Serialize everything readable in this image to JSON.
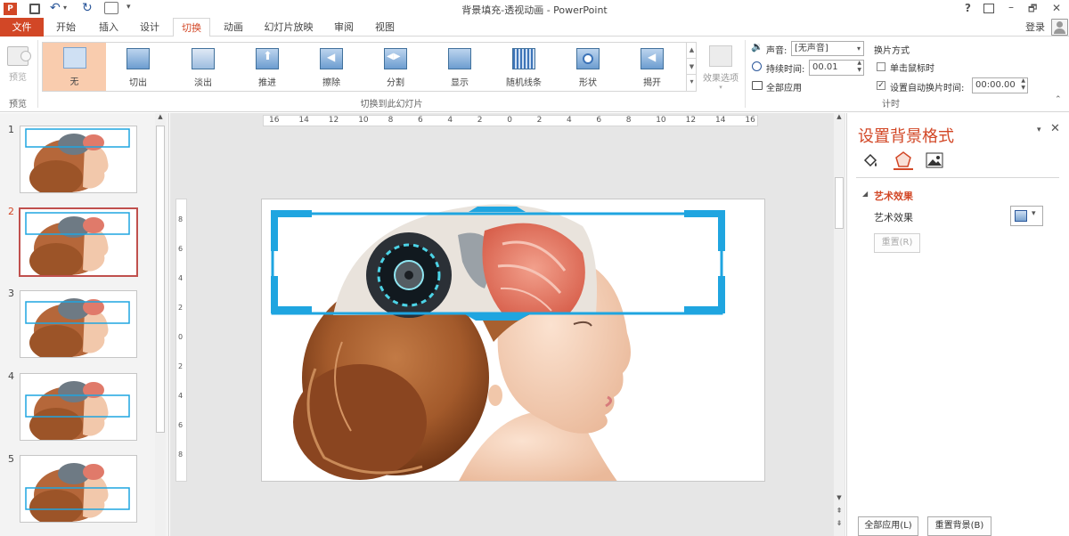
{
  "window": {
    "title": "背景填充-透视动画 - PowerPoint",
    "help": "?",
    "minimize": "–",
    "restore": "🗗",
    "close": "✕",
    "login": "登录"
  },
  "tabs": [
    {
      "label": "文件"
    },
    {
      "label": "开始"
    },
    {
      "label": "插入"
    },
    {
      "label": "设计"
    },
    {
      "label": "切换"
    },
    {
      "label": "动画"
    },
    {
      "label": "幻灯片放映"
    },
    {
      "label": "审阅"
    },
    {
      "label": "视图"
    }
  ],
  "ribbon": {
    "preview": "预览",
    "preview_group": "预览",
    "transitions": [
      "无",
      "切出",
      "淡出",
      "推进",
      "擦除",
      "分割",
      "显示",
      "随机线条",
      "形状",
      "揭开"
    ],
    "transitions_group": "切换到此幻灯片",
    "effect_options": "效果选项",
    "sound_label": "声音:",
    "sound_value": "[无声音]",
    "duration_label": "持续时间:",
    "duration_value": "00.01",
    "apply_all": "全部应用",
    "advance_title": "换片方式",
    "on_click": "单击鼠标时",
    "after_label": "设置自动换片时间:",
    "after_value": "00:00.00",
    "timing_group": "计时"
  },
  "slides": [
    {
      "num": "1"
    },
    {
      "num": "2"
    },
    {
      "num": "3"
    },
    {
      "num": "4"
    },
    {
      "num": "5"
    }
  ],
  "ruler": {
    "h_ticks": [
      "16",
      "14",
      "12",
      "10",
      "8",
      "6",
      "4",
      "2",
      "0",
      "2",
      "4",
      "6",
      "8",
      "10",
      "12",
      "14",
      "16"
    ],
    "v_ticks": [
      "8",
      "6",
      "4",
      "2",
      "0",
      "2",
      "4",
      "6",
      "8"
    ]
  },
  "format_pane": {
    "title": "设置背景格式",
    "section": "艺术效果",
    "row_label": "艺术效果",
    "reset": "重置(R)",
    "apply_all": "全部应用(L)",
    "reset_background": "重置背景(B)"
  },
  "colors": {
    "accent": "#d24726",
    "selection": "#1fa5e0",
    "active_tab": "#d24726"
  }
}
